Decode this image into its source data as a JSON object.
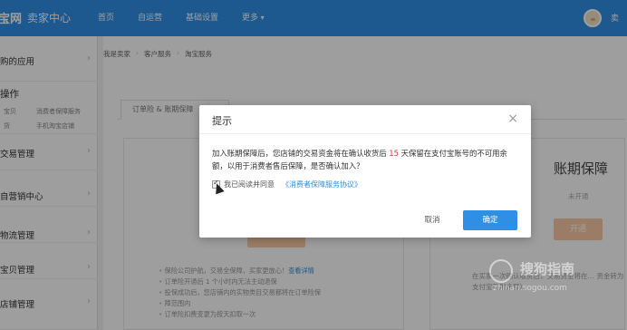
{
  "topbar": {
    "logo": "宝网",
    "brand": "卖家中心",
    "nav": [
      "首页",
      "自运营",
      "基础设置",
      "更多"
    ],
    "user": "卖"
  },
  "sidebar": {
    "top_item": "购的应用",
    "section_title": "操作",
    "section_links": [
      "宝贝",
      "消费者保障服务",
      "货",
      "手机淘宝店铺"
    ],
    "items": [
      "交易管理",
      "自营销中心",
      "物流管理",
      "宝贝管理",
      "店铺管理"
    ]
  },
  "breadcrumb": [
    "我是卖家",
    "客户服务",
    "淘宝服务"
  ],
  "tabs": {
    "active": "订单险 & 账期保障"
  },
  "left_card": {
    "notes": [
      {
        "text": "保险公司护航，交易全保障，买家更放心！",
        "link": "查看详情"
      },
      {
        "text": "订单险开通后 1 个小时内无法主动退保",
        "link": ""
      },
      {
        "text": "投保成功后，您店铺内的实物类目交易都将在订单险保",
        "link": ""
      },
      {
        "text": "障范围内",
        "link": ""
      },
      {
        "text": "订单险扣费变更为按天扣取一次",
        "link": ""
      }
    ]
  },
  "right_card": {
    "title": "账期保障",
    "status": "未开通",
    "open_label": "开通",
    "note": "在买家一次确认收货后，交易资金将在… 资金转为支付宝可用余额）。"
  },
  "dialog": {
    "title": "提示",
    "close": "×",
    "msg_part1": "加入账期保障后，您店铺的交易资金将在确认收货后",
    "msg_days": "15",
    "msg_part2": "天保留在支付宝账号的不可用余额，以用于消费者售后保障，是否确认加入？",
    "agree_text": "我已阅读并同意",
    "agree_link": "《消费者保障服务协议》",
    "cancel_label": "取消",
    "ok_label": "确定"
  },
  "watermark": {
    "text": "搜狗指南",
    "url": "zhinan.sogou.com"
  },
  "colors": {
    "topbar": "#2f8fe6",
    "primary": "#2f8fe6",
    "highlight": "#e4393c",
    "orange_button": "#fbcaa6"
  }
}
